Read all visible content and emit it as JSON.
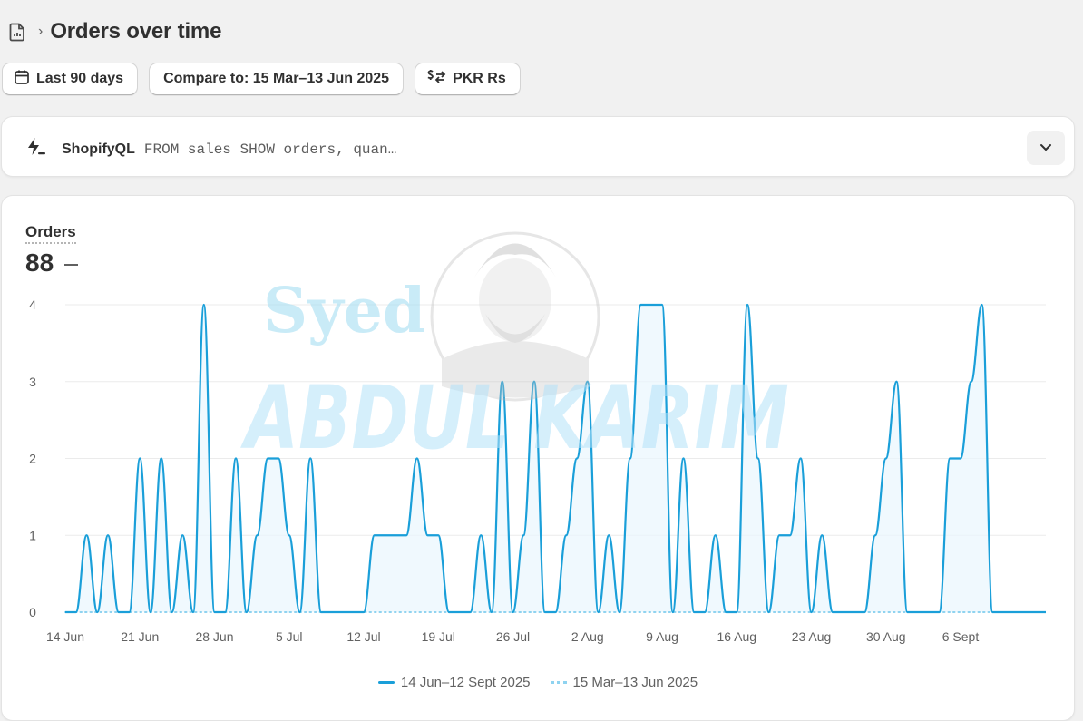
{
  "header": {
    "title": "Orders over time",
    "breadcrumb_separator": "›",
    "icon": "report-doc-icon"
  },
  "toolbar": {
    "date_range_label": "Last 90 days",
    "compare_label": "Compare to: 15 Mar–13 Jun 2025",
    "currency_label": "PKR Rs",
    "icons": [
      "calendar-icon",
      "currency-swap-icon"
    ]
  },
  "shopifyql": {
    "label": "ShopifyQL",
    "query": "FROM sales SHOW orders, quan…",
    "icon": "lightning-icon",
    "toggle_icon": "chevron-down-icon"
  },
  "metric": {
    "label": "Orders",
    "value": "88"
  },
  "watermark": {
    "line1": "Syed",
    "line2": "ABDUL KARIM",
    "avatar": "portrait-illustration"
  },
  "colors": {
    "current_series": "#1a9fd9",
    "comparison_series": "#8fd3f0",
    "fill": "#eaf7fd",
    "grid": "#ebebeb"
  },
  "chart_data": {
    "type": "line",
    "title": "",
    "xlabel": "",
    "ylabel": "",
    "ylim": [
      0,
      4
    ],
    "y_ticks": [
      "0",
      "1",
      "2",
      "3",
      "4"
    ],
    "x_tick_labels": [
      "14 Jun",
      "21 Jun",
      "28 Jun",
      "5 Jul",
      "12 Jul",
      "19 Jul",
      "26 Jul",
      "2 Aug",
      "9 Aug",
      "16 Aug",
      "23 Aug",
      "30 Aug",
      "6 Sept"
    ],
    "x_start_date": "2025-06-14",
    "legend_position": "bottom-center",
    "grid": true,
    "series": [
      {
        "name": "14 Jun–12 Sept 2025",
        "style": "solid",
        "values": [
          0,
          0,
          1,
          0,
          1,
          0,
          0,
          2,
          0,
          2,
          0,
          1,
          0,
          4,
          0,
          0,
          2,
          0,
          1,
          2,
          2,
          1,
          0,
          2,
          0,
          0,
          0,
          0,
          0,
          1,
          1,
          1,
          1,
          2,
          1,
          1,
          0,
          0,
          0,
          1,
          0,
          3,
          0,
          1,
          3,
          0,
          0,
          1,
          2,
          3,
          0,
          1,
          0,
          2,
          4,
          4,
          4,
          0,
          2,
          0,
          0,
          1,
          0,
          0,
          4,
          2,
          0,
          1,
          1,
          2,
          0,
          1,
          0,
          0,
          0,
          0,
          1,
          2,
          3,
          0,
          0,
          0,
          0,
          2,
          2,
          3,
          4,
          0,
          0,
          0,
          0,
          0,
          0
        ]
      },
      {
        "name": "15 Mar–13 Jun 2025",
        "style": "dotted",
        "values": [
          0,
          0,
          0,
          0,
          0,
          0,
          0,
          0,
          0,
          0,
          0,
          0,
          0,
          0,
          0,
          0,
          0,
          0,
          0,
          0,
          0,
          0,
          0,
          0,
          0,
          0,
          0,
          0,
          0,
          0,
          0,
          0,
          0,
          0,
          0,
          0,
          0,
          0,
          0,
          0,
          0,
          0,
          0,
          0,
          0,
          0,
          0,
          0,
          0,
          0,
          0,
          0,
          0,
          0,
          0,
          0,
          0,
          0,
          0,
          0,
          0,
          0,
          0,
          0,
          0,
          0,
          0,
          0,
          0,
          0,
          0,
          0,
          0,
          0,
          0,
          0,
          0,
          0,
          0,
          0,
          0,
          0,
          0,
          0,
          0,
          0,
          0,
          0,
          0,
          0,
          0,
          0,
          0
        ]
      }
    ]
  }
}
